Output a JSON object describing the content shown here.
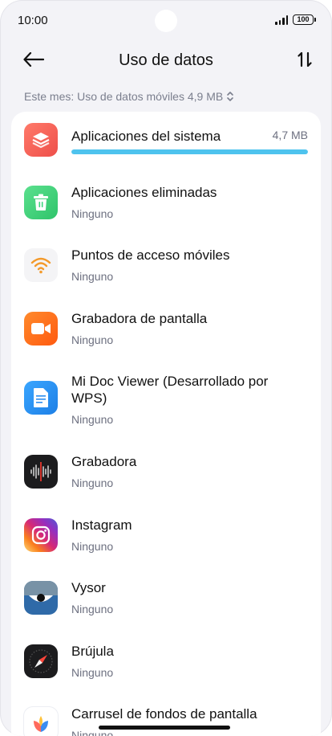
{
  "status": {
    "time": "10:00",
    "battery": "100"
  },
  "header": {
    "title": "Uso de datos"
  },
  "summary": {
    "text": "Este mes: Uso de datos móviles 4,9 MB"
  },
  "apps": [
    {
      "name": "Aplicaciones del sistema",
      "size": "4,7 MB",
      "usage_fraction": 1.0,
      "icon": "layers-icon",
      "color": "#f2605a"
    },
    {
      "name": "Aplicaciones eliminadas",
      "usage": "Ninguno",
      "icon": "trash-icon",
      "color": "#3ed67e"
    },
    {
      "name": "Puntos de acceso móviles",
      "usage": "Ninguno",
      "icon": "wifi-hotspot-icon",
      "color": "#f39a2b"
    },
    {
      "name": "Grabadora de pantalla",
      "usage": "Ninguno",
      "icon": "video-camera-icon",
      "color": "#ff6a18"
    },
    {
      "name": "Mi Doc Viewer (Desarrollado por WPS)",
      "usage": "Ninguno",
      "icon": "document-icon",
      "color": "#2a8df0"
    },
    {
      "name": "Grabadora",
      "usage": "Ninguno",
      "icon": "waveform-icon",
      "color": "#1c1c1e"
    },
    {
      "name": "Instagram",
      "usage": "Ninguno",
      "icon": "instagram-icon",
      "color": "#d6249f"
    },
    {
      "name": "Vysor",
      "usage": "Ninguno",
      "icon": "eye-icon",
      "color": "#3f6b8c"
    },
    {
      "name": "Brújula",
      "usage": "Ninguno",
      "icon": "compass-icon",
      "color": "#1c1c1e"
    },
    {
      "name": "Carrusel de fondos de pantalla",
      "usage": "Ninguno",
      "icon": "flower-icon",
      "color": "#ffffff"
    }
  ]
}
